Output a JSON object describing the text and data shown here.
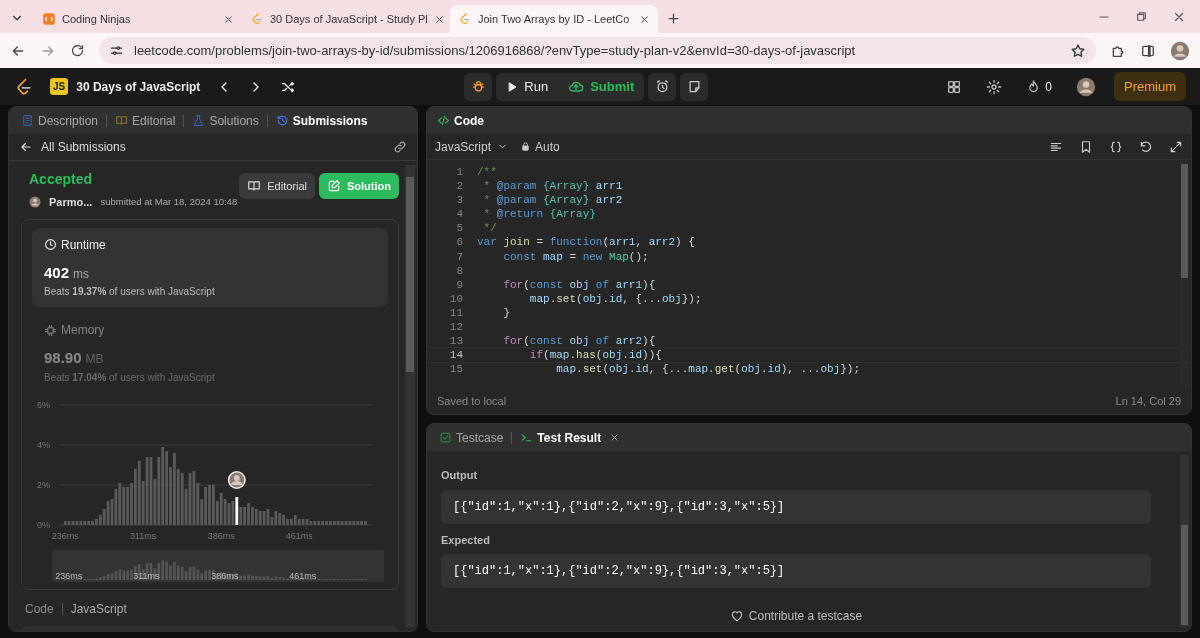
{
  "browser": {
    "tabs": [
      {
        "title": "Coding Ninjas",
        "kind": "ninja",
        "selected": false
      },
      {
        "title": "30 Days of JavaScript - Study Pl",
        "kind": "leetcode",
        "selected": false
      },
      {
        "title": "Join Two Arrays by ID - LeetCo",
        "kind": "leetcode",
        "selected": true
      }
    ],
    "url": "leetcode.com/problems/join-two-arrays-by-id/submissions/1206916868/?envType=study-plan-v2&envId=30-days-of-javascript"
  },
  "navbar": {
    "badge": "JS",
    "study_plan": "30 Days of JavaScript",
    "run": "Run",
    "submit": "Submit",
    "streak": "0",
    "premium": "Premium"
  },
  "left_panel": {
    "tabs": [
      {
        "label": "Description",
        "kind": "description",
        "selected": false
      },
      {
        "label": "Editorial",
        "kind": "editorial",
        "selected": false
      },
      {
        "label": "Solutions",
        "kind": "solutions",
        "selected": false
      },
      {
        "label": "Submissions",
        "kind": "submissions",
        "selected": true
      }
    ],
    "back": "All Submissions",
    "status": "Accepted",
    "user": "Parmo...",
    "submitted": "submitted at Mar 18, 2024 10:48",
    "buttons": [
      {
        "label": "Editorial",
        "kind": "secondary"
      },
      {
        "label": "Solution",
        "kind": "primary"
      }
    ],
    "stats": [
      {
        "kind": "runtime",
        "title": "Runtime",
        "value": "402",
        "unit": "ms",
        "beats": "Beats **19.37%** of users with JavaScript",
        "selected": true
      },
      {
        "kind": "memory",
        "title": "Memory",
        "value": "98.90",
        "unit": "MB",
        "beats": "Beats **17.04%** of users with JavaScript",
        "selected": false
      }
    ],
    "chart_data": {
      "type": "bar",
      "xlim": [
        231,
        531
      ],
      "ylim": [
        0,
        6
      ],
      "xticks": [
        {
          "value": 236,
          "label": "236ms"
        },
        {
          "value": 311,
          "label": "311ms"
        },
        {
          "value": 386,
          "label": "386ms"
        },
        {
          "value": 461,
          "label": "461ms"
        }
      ],
      "yticks": [
        {
          "value": 0,
          "label": "0%"
        },
        {
          "value": 2,
          "label": "2%"
        },
        {
          "value": 4,
          "label": "4%"
        },
        {
          "value": 6,
          "label": "6%"
        }
      ],
      "x": [
        236,
        239.75,
        243.5,
        247.25,
        251,
        254.75,
        258.5,
        262.25,
        266,
        269.75,
        273.5,
        277.25,
        281,
        284.75,
        288.5,
        292.25,
        296,
        299.75,
        303.5,
        307.25,
        311,
        314.75,
        318.5,
        322.25,
        326,
        329.75,
        333.5,
        337.25,
        341,
        344.75,
        348.5,
        352.25,
        356,
        359.75,
        363.5,
        367.25,
        371,
        374.75,
        378.5,
        382.25,
        386,
        389.75,
        393.5,
        397.25,
        401,
        404.75,
        408.5,
        412.25,
        416,
        419.75,
        423.5,
        427.25,
        431,
        434.75,
        438.5,
        442.25,
        446,
        449.75,
        453.5,
        457.25,
        461,
        464.75,
        468.5,
        472.25,
        476,
        479.75,
        483.5,
        487.25,
        491,
        494.75,
        498.5,
        502.25,
        506,
        509.75,
        513.5,
        517.25,
        521,
        524.75
      ],
      "values": [
        0.2,
        0.2,
        0.2,
        0.2,
        0.2,
        0.2,
        0.2,
        0.2,
        0.3,
        0.5,
        0.8,
        1.2,
        1.3,
        1.8,
        2.1,
        1.9,
        1.9,
        2.1,
        2.8,
        3.2,
        2.2,
        3.4,
        3.4,
        2.3,
        3.4,
        3.9,
        3.7,
        2.9,
        3.6,
        2.8,
        2.6,
        1.8,
        2.6,
        2.7,
        2.1,
        1.3,
        1.9,
        2.0,
        2.0,
        1.2,
        1.6,
        1.3,
        1.1,
        1.2,
        1.4,
        0.9,
        0.9,
        1.1,
        0.9,
        0.8,
        0.7,
        0.7,
        0.8,
        0.4,
        0.7,
        0.6,
        0.5,
        0.3,
        0.3,
        0.5,
        0.3,
        0.3,
        0.3,
        0.2,
        0.2,
        0.2,
        0.2,
        0.2,
        0.2,
        0.2,
        0.2,
        0.2,
        0.2,
        0.2,
        0.2,
        0.2,
        0.2,
        0.2
      ]
    },
    "overview": {
      "labels": [
        "236ms",
        "311ms",
        "386ms",
        "461ms"
      ]
    },
    "code_tabs": [
      "Code",
      "JavaScript"
    ]
  },
  "editor": {
    "title": "Code",
    "language": "JavaScript",
    "mode": "Auto",
    "lines": [
      {
        "num": "1",
        "current": false,
        "tokens": [
          {
            "t": "/**",
            "kind": "comment"
          }
        ]
      },
      {
        "num": "2",
        "current": false,
        "tokens": [
          {
            "t": " * ",
            "kind": "comment"
          },
          {
            "t": "@param",
            "kind": "tag"
          },
          {
            "t": " {Array}",
            "kind": "type"
          },
          {
            "t": " arr1",
            "kind": "var"
          }
        ]
      },
      {
        "num": "3",
        "current": false,
        "tokens": [
          {
            "t": " * ",
            "kind": "comment"
          },
          {
            "t": "@param",
            "kind": "tag"
          },
          {
            "t": " {Array}",
            "kind": "type"
          },
          {
            "t": " arr2",
            "kind": "var"
          }
        ]
      },
      {
        "num": "4",
        "current": false,
        "tokens": [
          {
            "t": " * ",
            "kind": "comment"
          },
          {
            "t": "@return",
            "kind": "tag"
          },
          {
            "t": " {Array}",
            "kind": "type"
          }
        ]
      },
      {
        "num": "5",
        "current": false,
        "tokens": [
          {
            "t": " */",
            "kind": "comment"
          }
        ]
      },
      {
        "num": "6",
        "current": false,
        "tokens": [
          {
            "t": "var",
            "kind": "kw"
          },
          {
            "t": " join",
            "kind": "fn"
          },
          {
            "t": " = ",
            "kind": "p"
          },
          {
            "t": "function",
            "kind": "kw"
          },
          {
            "t": "(",
            "kind": "p"
          },
          {
            "t": "arr1",
            "kind": "var"
          },
          {
            "t": ", ",
            "kind": "p"
          },
          {
            "t": "arr2",
            "kind": "var"
          },
          {
            "t": ") {",
            "kind": "p"
          }
        ]
      },
      {
        "num": "7",
        "current": false,
        "tokens": [
          {
            "t": "    const",
            "kind": "kw"
          },
          {
            "t": " map",
            "kind": "var"
          },
          {
            "t": " = ",
            "kind": "p"
          },
          {
            "t": "new",
            "kind": "kw"
          },
          {
            "t": " Map",
            "kind": "type"
          },
          {
            "t": "();",
            "kind": "p"
          }
        ]
      },
      {
        "num": "8",
        "current": false
      },
      {
        "num": "9",
        "current": false,
        "tokens": [
          {
            "t": "    for",
            "kind": "ctl"
          },
          {
            "t": "(",
            "kind": "p"
          },
          {
            "t": "const",
            "kind": "kw"
          },
          {
            "t": " obj",
            "kind": "var"
          },
          {
            "t": " of",
            "kind": "kw"
          },
          {
            "t": " arr1",
            "kind": "var"
          },
          {
            "t": "){",
            "kind": "p"
          }
        ]
      },
      {
        "num": "10",
        "current": false,
        "tokens": [
          {
            "t": "        map",
            "kind": "var"
          },
          {
            "t": ".",
            "kind": "p"
          },
          {
            "t": "set",
            "kind": "fn"
          },
          {
            "t": "(",
            "kind": "p"
          },
          {
            "t": "obj",
            "kind": "var"
          },
          {
            "t": ".",
            "kind": "p"
          },
          {
            "t": "id",
            "kind": "var"
          },
          {
            "t": ", {...",
            "kind": "p"
          },
          {
            "t": "obj",
            "kind": "var"
          },
          {
            "t": "});",
            "kind": "p"
          }
        ]
      },
      {
        "num": "11",
        "current": false,
        "tokens": [
          {
            "t": "    }",
            "kind": "p"
          }
        ]
      },
      {
        "num": "12",
        "current": false
      },
      {
        "num": "13",
        "current": false,
        "tokens": [
          {
            "t": "    for",
            "kind": "ctl"
          },
          {
            "t": "(",
            "kind": "p"
          },
          {
            "t": "const",
            "kind": "kw"
          },
          {
            "t": " obj",
            "kind": "var"
          },
          {
            "t": " of",
            "kind": "kw"
          },
          {
            "t": " arr2",
            "kind": "var"
          },
          {
            "t": "){",
            "kind": "p"
          }
        ]
      },
      {
        "num": "14",
        "current": true,
        "tokens": [
          {
            "t": "        if",
            "kind": "ctl"
          },
          {
            "t": "(",
            "kind": "p"
          },
          {
            "t": "map",
            "kind": "var"
          },
          {
            "t": ".",
            "kind": "p"
          },
          {
            "t": "has",
            "kind": "fn"
          },
          {
            "t": "(",
            "kind": "p"
          },
          {
            "t": "obj",
            "kind": "var"
          },
          {
            "t": ".",
            "kind": "p"
          },
          {
            "t": "id",
            "kind": "var"
          },
          {
            "t": ")){",
            "kind": "p"
          }
        ]
      },
      {
        "num": "15",
        "current": false,
        "tokens": [
          {
            "t": "            map",
            "kind": "var"
          },
          {
            "t": ".",
            "kind": "p"
          },
          {
            "t": "set",
            "kind": "fn"
          },
          {
            "t": "(",
            "kind": "p"
          },
          {
            "t": "obj",
            "kind": "var"
          },
          {
            "t": ".",
            "kind": "p"
          },
          {
            "t": "id",
            "kind": "var"
          },
          {
            "t": ", {...",
            "kind": "p"
          },
          {
            "t": "map",
            "kind": "var"
          },
          {
            "t": ".",
            "kind": "p"
          },
          {
            "t": "get",
            "kind": "fn"
          },
          {
            "t": "(",
            "kind": "p"
          },
          {
            "t": "obj",
            "kind": "var"
          },
          {
            "t": ".",
            "kind": "p"
          },
          {
            "t": "id",
            "kind": "var"
          },
          {
            "t": "), ...",
            "kind": "p"
          },
          {
            "t": "obj",
            "kind": "var"
          },
          {
            "t": "});",
            "kind": "p"
          }
        ]
      }
    ],
    "status": "Saved to local",
    "cursor": "Ln 14, Col 29"
  },
  "results": {
    "tabs": [
      {
        "label": "Testcase",
        "kind": "testcase",
        "selected": false
      },
      {
        "label": "Test Result",
        "kind": "result",
        "selected": true
      }
    ],
    "sections": [
      {
        "label": "Output",
        "value": "[{\"id\":1,\"x\":1},{\"id\":2,\"x\":9},{\"id\":3,\"x\":5}]"
      },
      {
        "label": "Expected",
        "value": "[{\"id\":1,\"x\":1},{\"id\":2,\"x\":9},{\"id\":3,\"x\":5}]"
      }
    ],
    "contribute": "Contribute a testcase"
  }
}
